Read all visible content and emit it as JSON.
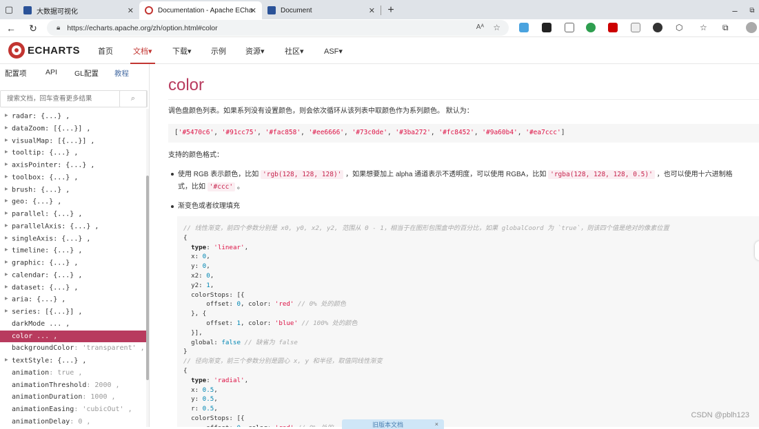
{
  "browser": {
    "tabs": [
      {
        "title": "大数据可视化",
        "active": false,
        "favicon_color": "#2a5298"
      },
      {
        "title": "Documentation - Apache EChart",
        "active": true,
        "favicon_color": "#c23531"
      },
      {
        "title": "Document",
        "active": false,
        "favicon_color": "#2a5298"
      }
    ],
    "new_tab_icon": "plus-icon",
    "url": "https://echarts.apache.org/zh/option.html#color",
    "window_button": "restore-icon"
  },
  "site": {
    "logo_text": "ECHARTS",
    "nav": [
      {
        "label": "首页",
        "active": false
      },
      {
        "label": "文档▾",
        "active": true
      },
      {
        "label": "下载▾",
        "active": false
      },
      {
        "label": "示例",
        "active": false
      },
      {
        "label": "资源▾",
        "active": false
      },
      {
        "label": "社区▾",
        "active": false
      },
      {
        "label": "ASF▾",
        "active": false
      }
    ]
  },
  "sidebar": {
    "tabs": [
      "配置项",
      "API",
      "GL配置",
      "教程"
    ],
    "active_tab": "配置项",
    "search_placeholder": "搜索文档，回车查看更多结果",
    "items": [
      {
        "key": "radar",
        "val": ": {...} ,",
        "expandable": true
      },
      {
        "key": "dataZoom",
        "val": ": [{...}] ,",
        "expandable": true
      },
      {
        "key": "visualMap",
        "val": ": [{...}] ,",
        "expandable": true
      },
      {
        "key": "tooltip",
        "val": ": {...} ,",
        "expandable": true
      },
      {
        "key": "axisPointer",
        "val": ": {...} ,",
        "expandable": true
      },
      {
        "key": "toolbox",
        "val": ": {...} ,",
        "expandable": true
      },
      {
        "key": "brush",
        "val": ": {...} ,",
        "expandable": true
      },
      {
        "key": "geo",
        "val": ": {...} ,",
        "expandable": true
      },
      {
        "key": "parallel",
        "val": ": {...} ,",
        "expandable": true
      },
      {
        "key": "parallelAxis",
        "val": ": {...} ,",
        "expandable": true
      },
      {
        "key": "singleAxis",
        "val": ": {...} ,",
        "expandable": true
      },
      {
        "key": "timeline",
        "val": ": {...} ,",
        "expandable": true
      },
      {
        "key": "graphic",
        "val": ": {...} ,",
        "expandable": true
      },
      {
        "key": "calendar",
        "val": ": {...} ,",
        "expandable": true
      },
      {
        "key": "dataset",
        "val": ": {...} ,",
        "expandable": true
      },
      {
        "key": "aria",
        "val": ": {...} ,",
        "expandable": true
      },
      {
        "key": "series",
        "val": ": [{...}] ,",
        "expandable": true
      },
      {
        "key": "darkMode",
        "val": " ... ,",
        "expandable": false
      },
      {
        "key": "color",
        "val": " ... ,",
        "expandable": false,
        "selected": true
      },
      {
        "key": "backgroundColor",
        "val": ": 'transparent' ,",
        "expandable": false
      },
      {
        "key": "textStyle",
        "val": ": {...} ,",
        "expandable": true
      },
      {
        "key": "animation",
        "val": ": true ,",
        "expandable": false
      },
      {
        "key": "animationThreshold",
        "val": ": 2000 ,",
        "expandable": false
      },
      {
        "key": "animationDuration",
        "val": ": 1000 ,",
        "expandable": false
      },
      {
        "key": "animationEasing",
        "val": ": 'cubicOut' ,",
        "expandable": false
      },
      {
        "key": "animationDelay",
        "val": ": 0 ,",
        "expandable": false
      }
    ]
  },
  "content": {
    "title": "color",
    "desc": "调色盘颜色列表。如果系列没有设置颜色，则会依次循环从该列表中取颜色作为系列颜色。 默认为：",
    "default_code": "['#5470c6', '#91cc75', '#fac858', '#ee6666', '#73c0de', '#3ba272', '#fc8452', '#9a60b4', '#ea7ccc']",
    "formats_label": "支持的颜色格式：",
    "bullet1_a": "使用 RGB 表示颜色，比如 ",
    "bullet1_code1": "'rgb(128, 128, 128)'",
    "bullet1_b": " ，如果想要加上 alpha 通道表示不透明度，可以使用 RGBA，比如 ",
    "bullet1_code2": "'rgba(128, 128, 128, 0.5)'",
    "bullet1_c": " ，也可以使用十六进制格",
    "bullet1_d": "式，比如 ",
    "bullet1_code3": "'#ccc'",
    "bullet1_e": " 。",
    "bullet2": "渐变色或者纹理填充",
    "code_lines": [
      "// 线性渐变，前四个参数分别是 x0, y0, x2, y2, 范围从 0 - 1，相当于在图形包围盒中的百分比，如果 globalCoord 为 `true`，则该四个值是绝对的像素位置",
      "{",
      "  type: 'linear',",
      "  x: 0,",
      "  y: 0,",
      "  x2: 0,",
      "  y2: 1,",
      "  colorStops: [{",
      "      offset: 0, color: 'red' // 0% 处的颜色",
      "  }, {",
      "      offset: 1, color: 'blue' // 100% 处的颜色",
      "  }],",
      "  global: false // 缺省为 false",
      "}",
      "// 径向渐变，前三个参数分别是圆心 x, y 和半径，取值同线性渐变",
      "{",
      "  type: 'radial',",
      "  x: 0.5,",
      "  y: 0.5,",
      "  r: 0.5,",
      "  colorStops: [{",
      "      offset: 0, color: 'red' // 0% 处的"
    ],
    "old_version_tip": "旧版本文档",
    "tip_close": "×"
  },
  "watermark": "CSDN @pblh123"
}
